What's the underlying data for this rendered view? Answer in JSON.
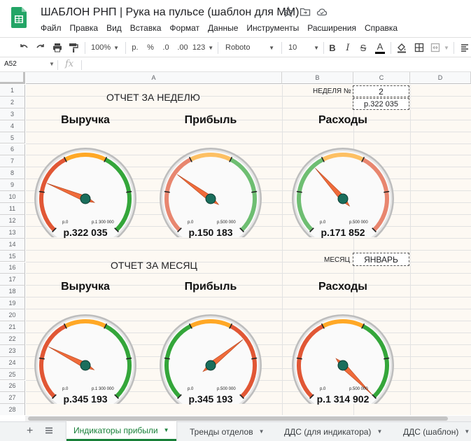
{
  "app": {
    "title": "ШАБЛОН РНП | Рука на пульсе (шаблон для ММ)",
    "menu": [
      "Файл",
      "Правка",
      "Вид",
      "Вставка",
      "Формат",
      "Данные",
      "Инструменты",
      "Расширения",
      "Справка"
    ]
  },
  "toolbar": {
    "zoom": "100%",
    "currency": "р.",
    "percent": "%",
    "dec_decrease": ".0",
    "dec_increase": ".00",
    "more_formats": "123",
    "font": "Roboto",
    "font_size": "10",
    "bold": "B",
    "italic": "I",
    "strike": "S",
    "text_color": "A"
  },
  "formula_bar": {
    "cell_ref": "A52",
    "fx": "fx"
  },
  "columns": [
    "A",
    "B",
    "C",
    "D"
  ],
  "rows": [
    "1",
    "2",
    "3",
    "4",
    "5",
    "6",
    "7",
    "8",
    "9",
    "10",
    "11",
    "12",
    "13",
    "14",
    "15",
    "16",
    "17",
    "18",
    "19",
    "20",
    "21",
    "22",
    "23",
    "24",
    "25",
    "26",
    "27",
    "28"
  ],
  "sheet": {
    "week_header": "ОТЧЕТ ЗА НЕДЕЛЮ",
    "week_label": "НЕДЕЛЯ №",
    "week_number": "2",
    "week_total": "р.322 035",
    "month_header": "ОТЧЕТ ЗА МЕСЯЦ",
    "month_label": "МЕСЯЦ",
    "month_value": "ЯНВАРЬ"
  },
  "gauges": {
    "week": [
      {
        "title": "Выручка",
        "value": "р.322 035",
        "min_label": "р.0",
        "max_label": "р.1 300 000",
        "fraction": 0.248,
        "bands": "red-orange-green"
      },
      {
        "title": "Прибыль",
        "value": "р.150 183",
        "min_label": "р.0",
        "max_label": "р.500 000",
        "fraction": 0.3,
        "bands": "red-orange-green"
      },
      {
        "title": "Расходы",
        "value": "р.171 852",
        "min_label": "р.0",
        "max_label": "р.500 000",
        "fraction": 0.344,
        "bands": "green-orange-red"
      }
    ],
    "month": [
      {
        "title": "Выручка",
        "value": "р.345 193",
        "min_label": "р.0",
        "max_label": "р.1 300 000",
        "fraction": 0.266,
        "bands": "red-orange-green"
      },
      {
        "title": "Прибыль",
        "value": "р.345 193",
        "min_label": "р.0",
        "max_label": "р.500 000",
        "fraction": 0.69,
        "bands": "green-orange-red"
      },
      {
        "title": "Расходы",
        "value": "р.1 314 902",
        "min_label": "р.0",
        "max_label": "р.500 000",
        "fraction": 1.0,
        "bands": "red-orange-green"
      }
    ]
  },
  "colors": {
    "gauge_red": "#dc3912",
    "gauge_orange": "#ff9900",
    "gauge_green": "#109618",
    "needle": "#f06b3a",
    "needle_hub": "#1a6e5c",
    "sheet_bg": "#fdf9f3",
    "active_tab": "#188038"
  },
  "tabs": [
    {
      "label": "Индикаторы прибыли",
      "active": true
    },
    {
      "label": "Тренды отделов",
      "active": false
    },
    {
      "label": "ДДС (для индикатора)",
      "active": false
    },
    {
      "label": "ДДС (шаблон)",
      "active": false
    }
  ]
}
